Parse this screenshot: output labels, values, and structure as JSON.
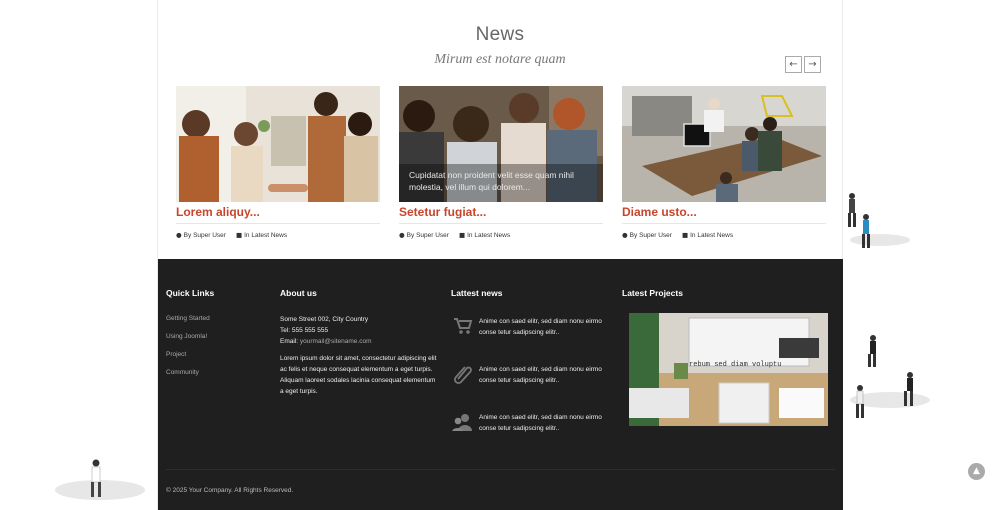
{
  "news": {
    "title": "News",
    "subtitle": "Mirum est notare quam",
    "prev_icon": "arrow-left-icon",
    "next_icon": "arrow-right-icon",
    "cards": [
      {
        "title": "Lorem aliquy...",
        "author": "By Super User",
        "category": "In Latest News",
        "overlay": ""
      },
      {
        "title": "Setetur fugiat...",
        "author": "By Super User",
        "category": "In Latest News",
        "overlay": "Cupidatat non proident velit esse quam nihil molestia, vel illum qui dolorem..."
      },
      {
        "title": "Diame usto...",
        "author": "By Super User",
        "category": "In Latest News",
        "overlay": ""
      }
    ]
  },
  "footer": {
    "quick_links": {
      "heading": "Quick Links",
      "items": [
        "Getting Started",
        "Using Joomla!",
        "Project",
        "Community"
      ]
    },
    "about": {
      "heading": "About us",
      "address": "Some Street 002, City Country",
      "tel": "Tel: 555 555 555",
      "email_label": "Email:",
      "email": "yourmail@sitename.com",
      "text": "Lorem ipsum dolor sit amet, consectetur adipiscing elit ac felis et neque consequat elementum a eget turpis. Aliquam laoreet sodales lacinia consequat elementum a eget turpis."
    },
    "latest_news": {
      "heading": "Lattest news",
      "items": [
        {
          "icon": "shopping-cart-icon",
          "text": "Anime con saed elitr, sed diam nonu eirmo conse tetur sadipscing elitr.."
        },
        {
          "icon": "paperclip-icon",
          "text": "Anime con saed elitr, sed diam nonu eirmo conse tetur sadipscing elitr.."
        },
        {
          "icon": "users-icon",
          "text": "Anime con saed elitr, sed diam nonu eirmo conse tetur sadipscing elitr.."
        }
      ]
    },
    "projects": {
      "heading": "Latest Projects",
      "caption": "rebum sed diam voluptu"
    },
    "copyright": "© 2025 Your Company. All Rights Reserved."
  },
  "back_to_top_icon": "chevron-up-icon",
  "colors": {
    "accent": "#c8452b",
    "footer_bg": "#1f1f1f"
  }
}
